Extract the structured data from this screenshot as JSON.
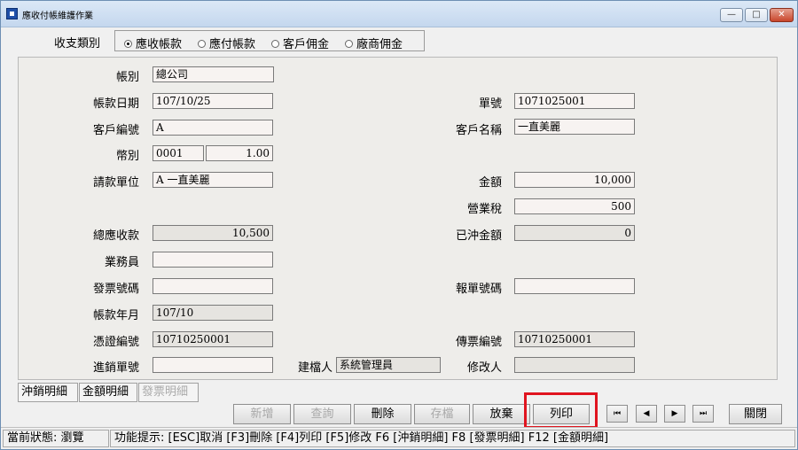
{
  "window": {
    "title": "應收付帳維護作業",
    "min": "—",
    "max": "□",
    "close": "✕"
  },
  "type_group": {
    "label": "收支類別",
    "options": [
      "應收帳款",
      "應付帳款",
      "客戶佣金",
      "廠商佣金"
    ],
    "selected": "應收帳款"
  },
  "form": {
    "account": {
      "label": "帳別",
      "value": "總公司"
    },
    "date": {
      "label": "帳款日期",
      "value": "107/10/25"
    },
    "doc_no": {
      "label": "單號",
      "value": "1071025001"
    },
    "customer_code": {
      "label": "客戶編號",
      "value": "A"
    },
    "customer_name": {
      "label": "客戶名稱",
      "value": "一直美麗"
    },
    "currency": {
      "label": "幣別",
      "code": "0001",
      "rate": "1.00"
    },
    "billing_unit": {
      "label": "請款單位",
      "value": "A 一直美麗"
    },
    "amount": {
      "label": "金額",
      "value": "10,000"
    },
    "tax": {
      "label": "營業稅",
      "value": "500"
    },
    "total": {
      "label": "總應收款",
      "value": "10,500"
    },
    "offset": {
      "label": "已沖金額",
      "value": "0"
    },
    "sales": {
      "label": "業務員",
      "value": ""
    },
    "invoice_no": {
      "label": "發票號碼",
      "value": ""
    },
    "report_no": {
      "label": "報單號碼",
      "value": ""
    },
    "period": {
      "label": "帳款年月",
      "value": "107/10"
    },
    "voucher_no": {
      "label": "憑證編號",
      "value": "10710250001"
    },
    "slip_no": {
      "label": "傳票編號",
      "value": "10710250001"
    },
    "sales_no": {
      "label": "進銷單號",
      "value": ""
    },
    "creator": {
      "label": "建檔人",
      "value": "系統管理員"
    },
    "modifier": {
      "label": "修改人",
      "value": ""
    }
  },
  "tabs": [
    "沖銷明細",
    "金額明細",
    "發票明細"
  ],
  "buttons": {
    "new": "新增",
    "query": "查詢",
    "delete": "刪除",
    "save": "存檔",
    "discard": "放棄",
    "print": "列印",
    "close": "關閉"
  },
  "nav": {
    "first": "⏮",
    "prev": "◀",
    "next": "▶",
    "last": "⏭"
  },
  "status": {
    "state_label": "當前狀態:",
    "state_value": "瀏覽",
    "hint": "功能提示: [ESC]取消 [F3]刪除 [F4]列印 [F5]修改 F6 [沖銷明細] F8 [發票明細] F12 [金額明細]"
  }
}
